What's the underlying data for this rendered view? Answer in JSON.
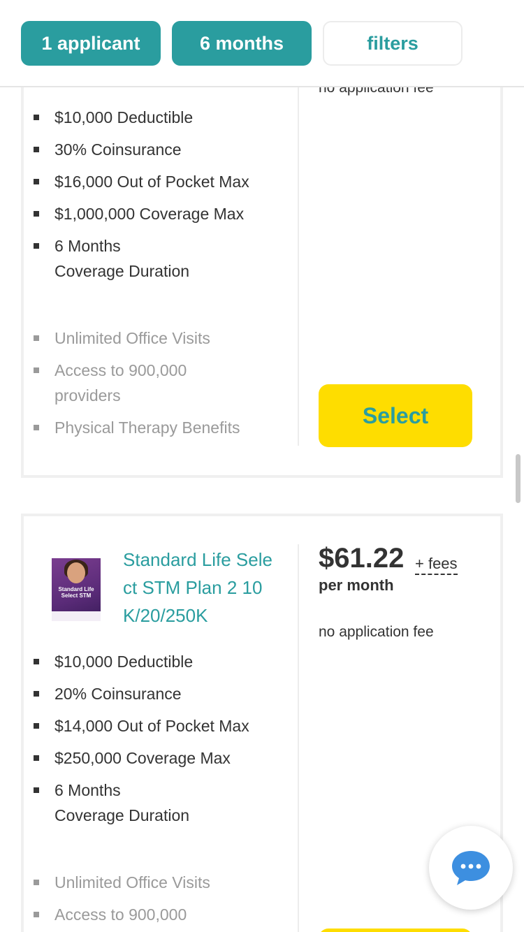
{
  "filters": {
    "applicants": "1 applicant",
    "duration": "6 months",
    "filters": "filters"
  },
  "card1": {
    "fee_text": "no application fee",
    "features": [
      "$10,000 Deductible",
      "30% Coinsurance",
      "$16,000 Out of Pocket Max",
      "$1,000,000 Coverage Max"
    ],
    "duration_value": "6 Months",
    "duration_label": "Coverage Duration",
    "extras": [
      "Unlimited Office Visits",
      "Access to 900,000",
      "providers",
      "Physical Therapy Benefits"
    ],
    "select_label": "Select"
  },
  "card2": {
    "thumb_caption": "Standard Life\nSelect STM",
    "title": "Standard Life Select STM Plan 2 10K/20/250K",
    "price": "$61.22",
    "fees_link": "+ fees",
    "per_month": "per month",
    "fee_text": "no application fee",
    "features": [
      "$10,000 Deductible",
      "20% Coinsurance",
      "$14,000 Out of Pocket Max",
      "$250,000 Coverage Max"
    ],
    "duration_value": "6 Months",
    "duration_label": "Coverage Duration",
    "extras": [
      "Unlimited Office Visits",
      "Access to 900,000"
    ]
  },
  "colors": {
    "accent": "#2a9d9f",
    "select_button": "#fedd00",
    "chat_icon": "#3d8fe0"
  },
  "icons": {
    "chat": "chat-bubble-icon"
  }
}
